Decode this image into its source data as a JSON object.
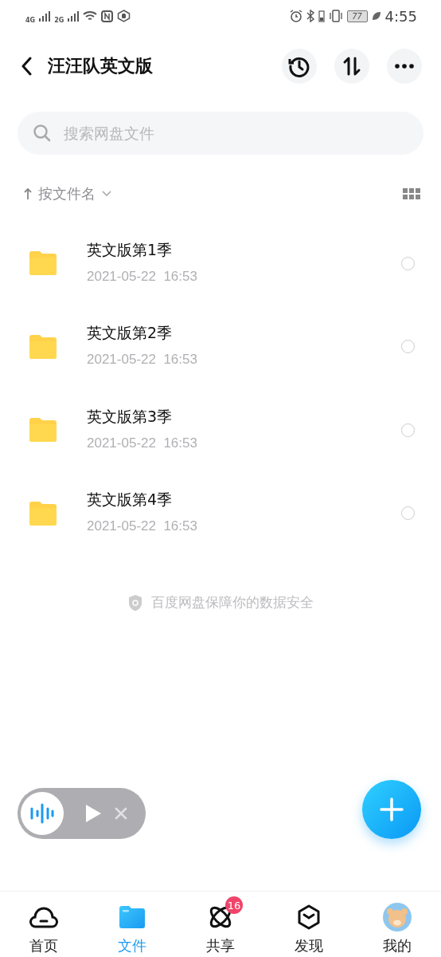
{
  "status_bar": {
    "network_1": "4G",
    "network_2": "2G",
    "battery": "77",
    "time": "4:55"
  },
  "header": {
    "title": "汪汪队英文版"
  },
  "search": {
    "placeholder": "搜索网盘文件"
  },
  "sort": {
    "label": "按文件名"
  },
  "files": [
    {
      "name": "英文版第1季",
      "modified": "2021-05-22  16:53",
      "selected": false
    },
    {
      "name": "英文版第2季",
      "modified": "2021-05-22  16:53",
      "selected": false
    },
    {
      "name": "英文版第3季",
      "modified": "2021-05-22  16:53",
      "selected": false
    },
    {
      "name": "英文版第4季",
      "modified": "2021-05-22  16:53",
      "selected": false
    }
  ],
  "footer_note": "百度网盘保障你的数据安全",
  "nav": [
    {
      "label": "首页",
      "selected": false
    },
    {
      "label": "文件",
      "selected": true
    },
    {
      "label": "共享",
      "selected": false,
      "badge": "16"
    },
    {
      "label": "发现",
      "selected": false
    },
    {
      "label": "我的",
      "selected": false
    }
  ]
}
